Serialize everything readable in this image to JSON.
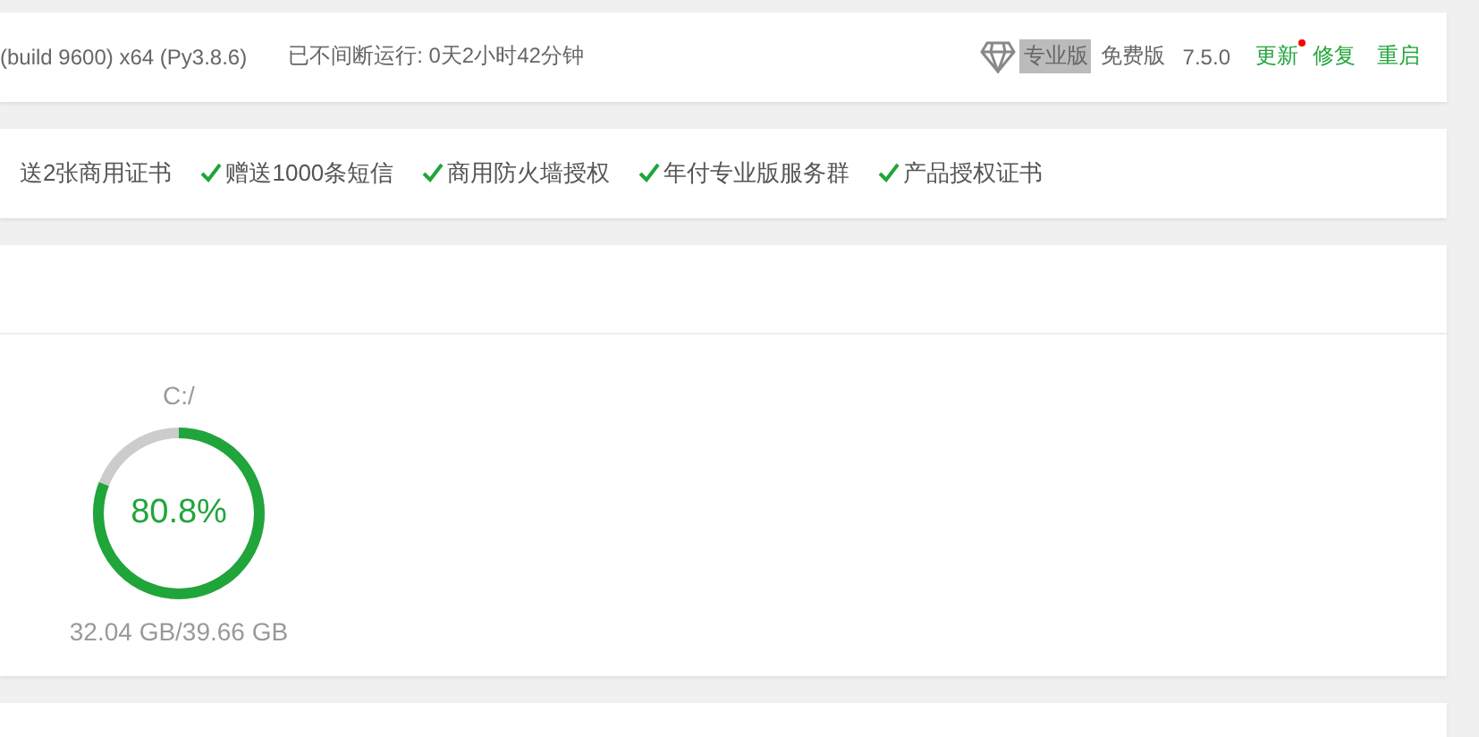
{
  "system_bar": {
    "os_info": "(build 9600) x64 (Py3.8.6)",
    "uptime": "已不间断运行: 0天2小时42分钟",
    "pro_badge": "专业版",
    "edition": "免费版",
    "version": "7.5.0",
    "actions": [
      {
        "label": "更新",
        "notify": true
      },
      {
        "label": "修复",
        "notify": false
      },
      {
        "label": "重启",
        "notify": false
      }
    ]
  },
  "perks": [
    {
      "label": "送2张商用证书",
      "checked": false
    },
    {
      "label": "赠送1000条短信",
      "checked": true
    },
    {
      "label": "商用防火墙授权",
      "checked": true
    },
    {
      "label": "年付专业版服务群",
      "checked": true
    },
    {
      "label": "产品授权证书",
      "checked": true
    }
  ],
  "disks": [
    {
      "path": "C:/",
      "percent": "80.8%",
      "level": 0.808,
      "usage": "32.04 GB/39.66 GB"
    }
  ]
}
